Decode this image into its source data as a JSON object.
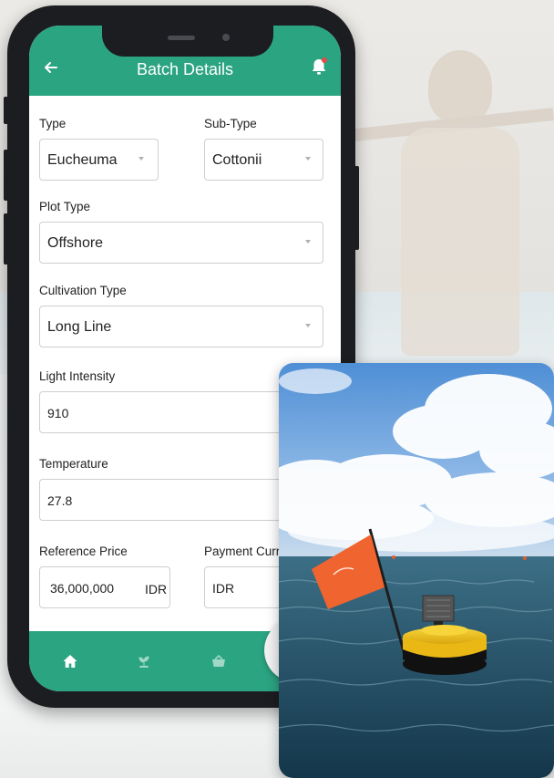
{
  "header": {
    "title": "Batch Details"
  },
  "form": {
    "type": {
      "label": "Type",
      "value": "Eucheuma"
    },
    "sub_type": {
      "label": "Sub-Type",
      "value": "Cottonii"
    },
    "plot_type": {
      "label": "Plot Type",
      "value": "Offshore"
    },
    "cultivation_type": {
      "label": "Cultivation Type",
      "value": "Long Line"
    },
    "light_intensity": {
      "label": "Light Intensity",
      "value": "910"
    },
    "temperature": {
      "label": "Temperature",
      "value": "27.8"
    },
    "reference_price": {
      "label": "Reference Price",
      "value": "36,000,000",
      "suffix": "IDR"
    },
    "payment_currency": {
      "label": "Payment Curre",
      "value": "IDR"
    }
  },
  "bottom_nav": {
    "items": [
      {
        "icon": "home-icon"
      },
      {
        "icon": "seedling-icon"
      },
      {
        "icon": "basket-icon"
      }
    ]
  },
  "colors": {
    "brand_green": "#2ba482",
    "notification_dot": "#e8494b",
    "buoy_yellow": "#f3c312",
    "flag_orange": "#f0642f"
  }
}
